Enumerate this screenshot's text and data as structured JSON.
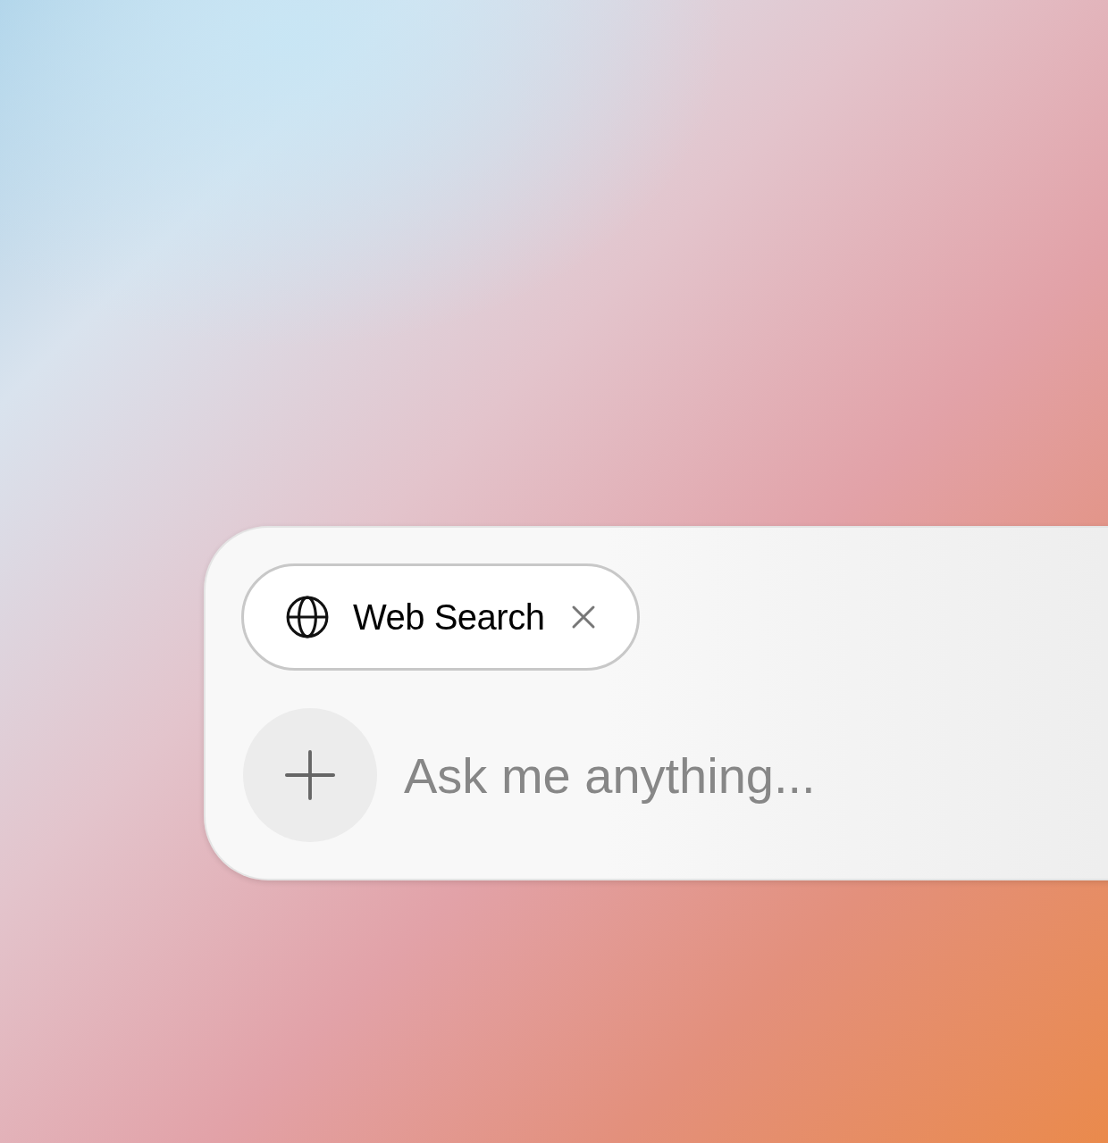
{
  "composer": {
    "chips": [
      {
        "label": "Web Search"
      }
    ],
    "input": {
      "placeholder": "Ask me anything..."
    }
  }
}
